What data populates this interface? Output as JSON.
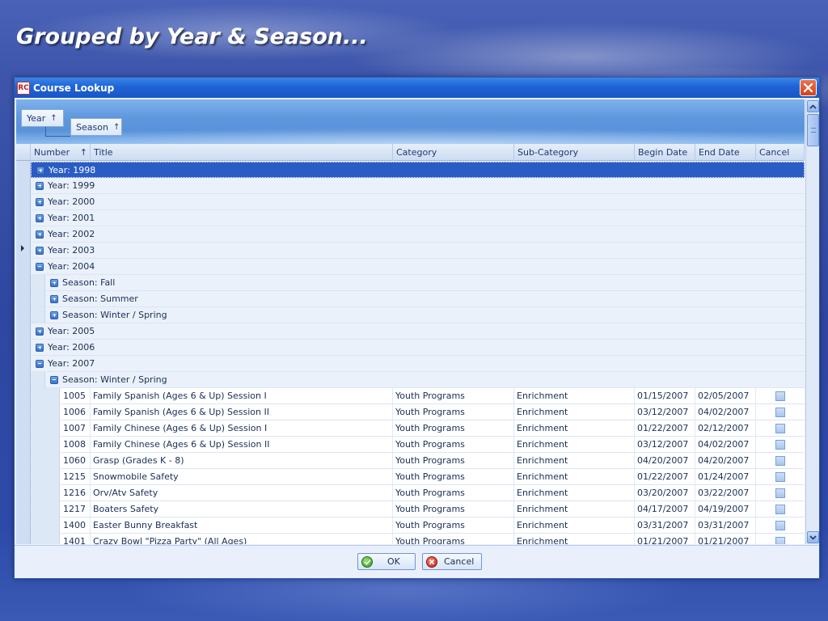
{
  "slide": {
    "title": "Grouped by Year & Season..."
  },
  "window": {
    "title": "Course Lookup",
    "logo_text": "RC"
  },
  "group_panel": {
    "chips": [
      {
        "label": "Year",
        "sort": "↑"
      },
      {
        "label": "Season",
        "sort": "↑"
      }
    ]
  },
  "columns": [
    {
      "label": "Number",
      "sort": "↑"
    },
    {
      "label": "Title"
    },
    {
      "label": "Category"
    },
    {
      "label": "Sub-Category"
    },
    {
      "label": "Begin Date"
    },
    {
      "label": "End Date"
    },
    {
      "label": "Cancel"
    }
  ],
  "groups": {
    "y1998": "Year: 1998",
    "y1999": "Year: 1999",
    "y2000": "Year: 2000",
    "y2001": "Year: 2001",
    "y2002": "Year: 2002",
    "y2003": "Year: 2003",
    "y2004": "Year: 2004",
    "s2004_fall": "Season: Fall",
    "s2004_summer": "Season: Summer",
    "s2004_winter": "Season: Winter / Spring",
    "y2005": "Year: 2005",
    "y2006": "Year: 2006",
    "y2007": "Year: 2007",
    "s2007_winter": "Season: Winter / Spring"
  },
  "rows": [
    {
      "number": "1005",
      "title": "Family Spanish (Ages 6 & Up) Session I",
      "category": "Youth Programs",
      "subcategory": "Enrichment",
      "begin": "01/15/2007",
      "end": "02/05/2007"
    },
    {
      "number": "1006",
      "title": "Family Spanish (Ages 6 & Up) Session II",
      "category": "Youth Programs",
      "subcategory": "Enrichment",
      "begin": "03/12/2007",
      "end": "04/02/2007"
    },
    {
      "number": "1007",
      "title": "Family Chinese (Ages 6 & Up) Session I",
      "category": "Youth Programs",
      "subcategory": "Enrichment",
      "begin": "01/22/2007",
      "end": "02/12/2007"
    },
    {
      "number": "1008",
      "title": "Family Chinese (Ages 6 & Up) Session II",
      "category": "Youth Programs",
      "subcategory": "Enrichment",
      "begin": "03/12/2007",
      "end": "04/02/2007"
    },
    {
      "number": "1060",
      "title": "Grasp (Grades K - 8)",
      "category": "Youth Programs",
      "subcategory": "Enrichment",
      "begin": "04/20/2007",
      "end": "04/20/2007"
    },
    {
      "number": "1215",
      "title": "Snowmobile Safety",
      "category": "Youth Programs",
      "subcategory": "Enrichment",
      "begin": "01/22/2007",
      "end": "01/24/2007"
    },
    {
      "number": "1216",
      "title": "Orv/Atv Safety",
      "category": "Youth Programs",
      "subcategory": "Enrichment",
      "begin": "03/20/2007",
      "end": "03/22/2007"
    },
    {
      "number": "1217",
      "title": "Boaters Safety",
      "category": "Youth Programs",
      "subcategory": "Enrichment",
      "begin": "04/17/2007",
      "end": "04/19/2007"
    },
    {
      "number": "1400",
      "title": "Easter Bunny Breakfast",
      "category": "Youth Programs",
      "subcategory": "Enrichment",
      "begin": "03/31/2007",
      "end": "03/31/2007"
    },
    {
      "number": "1401",
      "title": "Crazy Bowl \"Pizza Party\" (All Ages)",
      "category": "Youth Programs",
      "subcategory": "Enrichment",
      "begin": "01/21/2007",
      "end": "01/21/2007"
    }
  ],
  "footer": {
    "ok_label": "OK",
    "cancel_label": "Cancel"
  },
  "colors": {
    "selection": "#2a5cc4",
    "titlebar": "#1f63d6",
    "close": "#d4421c"
  },
  "icons": {
    "expand": "plus-box-icon",
    "collapse": "minus-box-icon",
    "ok": "check-circle-icon",
    "cancel": "x-circle-icon"
  }
}
